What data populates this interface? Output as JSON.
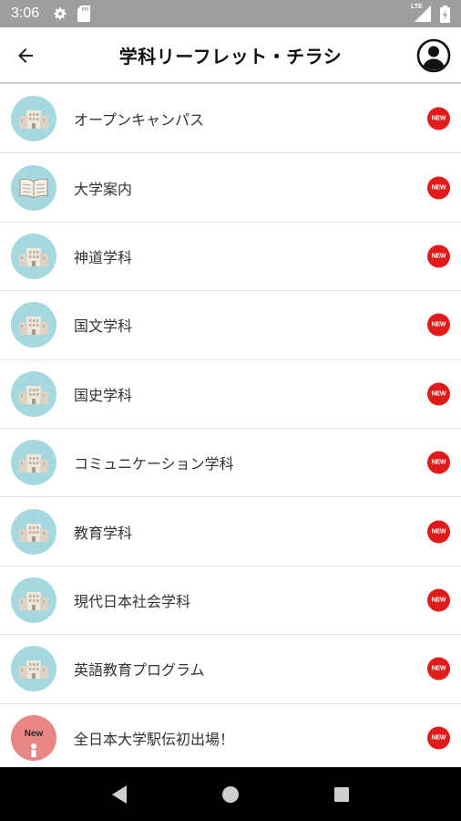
{
  "status_bar": {
    "time": "3:06",
    "icons": [
      "settings-icon",
      "sd-card-icon",
      "lte-signal-icon",
      "battery-charging-icon"
    ],
    "network": "LTE"
  },
  "app_bar": {
    "title": "学科リーフレット・チラシ",
    "back_icon": "arrow-left-icon",
    "account_icon": "account-circle-icon"
  },
  "badge_label": "NEW",
  "new_avatar_label": "New",
  "colors": {
    "status_bar": "#9e9e9e",
    "avatar_default": "#a6d8e0",
    "avatar_new": "#e88585",
    "badge": "#e11b1b",
    "nav_bar": "#000000"
  },
  "items": [
    {
      "label": "オープンキャンパス",
      "icon": "building-icon"
    },
    {
      "label": "大学案内",
      "icon": "book-icon"
    },
    {
      "label": "神道学科",
      "icon": "building-icon"
    },
    {
      "label": "国文学科",
      "icon": "building-icon"
    },
    {
      "label": "国史学科",
      "icon": "building-icon"
    },
    {
      "label": "コミュニケーション学科",
      "icon": "building-icon"
    },
    {
      "label": "教育学科",
      "icon": "building-icon"
    },
    {
      "label": "現代日本社会学科",
      "icon": "building-icon"
    },
    {
      "label": "英語教育プログラム",
      "icon": "building-icon"
    },
    {
      "label": "全日本大学駅伝初出場！",
      "icon": "info-new-icon"
    }
  ],
  "nav": {
    "back": "triangle-back-icon",
    "home": "circle-home-icon",
    "recents": "square-recents-icon"
  }
}
